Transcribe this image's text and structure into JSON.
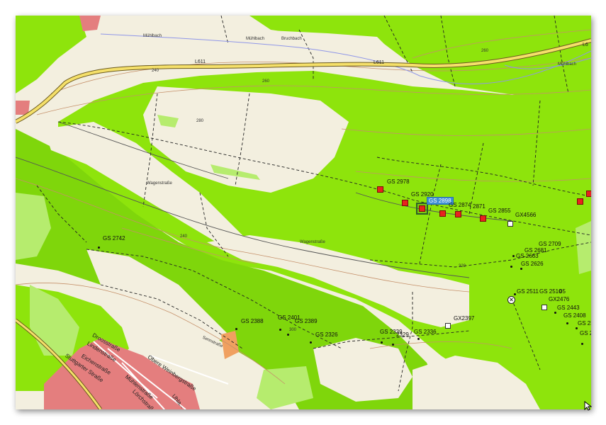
{
  "colors": {
    "forest": "#8ee40c",
    "forest_dark": "#76cf0a",
    "meadow": "#f3efdf",
    "settlement": "#e47e7e",
    "road_main": "#f5e06a",
    "water": "#8f96e8",
    "contour": "#c5906a",
    "selected_label": "#3d8fd6",
    "marker": "#e8231e"
  },
  "roads": {
    "l611_a": "L611",
    "l611_b": "L611",
    "l611_c": "L6",
    "wagenstrasse_a": "Wagenstraße",
    "wagenstrasse_b": "Wagenstraße",
    "sennstrasse": "Sennstraße"
  },
  "streams": {
    "muehlbach_a": "Mühlbach",
    "muehlbach_b": "Mühlbach",
    "bruchbach": "Bruchbach",
    "stream_right": "Mühlbach"
  },
  "contours": {
    "c240_a": "240",
    "c260_a": "260",
    "c260_b": "260",
    "c240_b": "240",
    "c280": "280",
    "c300": "300",
    "c320": "320"
  },
  "city_streets": {
    "s1": "Droosstraße",
    "s2": "Lindenstraße",
    "s3": "Eichenstraße",
    "s4": "Stuttgarter Straße",
    "s5": "Obere Weinbergstraße",
    "s6": "Mühlenstraße",
    "s7": "Lörchstraße",
    "s8": "Uhla..."
  },
  "waypoints": {
    "gs2978": "GS 2978",
    "gs2920": "GS 2920",
    "gs2898": "GS 2898",
    "gs2874": "GS 2874",
    "gs2871": "2871",
    "gs2855": "GS 2855",
    "gx4566": "GX4566",
    "gs2742": "GS 2742",
    "gs2709": "GS 2709",
    "gs2681": "GS 2681",
    "gs2663": "GS 2663",
    "gs2626": "GS 2626",
    "gs2511": "GS 2511",
    "gs2510": "GS 2510",
    "gs2505": "05",
    "gx2476": "GX2476",
    "gs2443": "GS 2443",
    "gs2408": "GS 2408",
    "gs23x": "GS 23",
    "gs2388": "GS 2388",
    "gs2401": "GS 2401",
    "gs2389": "GS 2389",
    "gs2326": "GS 2326",
    "gs2339": "GS 2339",
    "gs2329": "2329",
    "gs2336": "GS 2336",
    "gx2397": "GX2397",
    "gs2x": "GS 2"
  },
  "icons": {
    "target": "crosshair-x-icon",
    "cursor": "mouse-pointer-icon"
  }
}
